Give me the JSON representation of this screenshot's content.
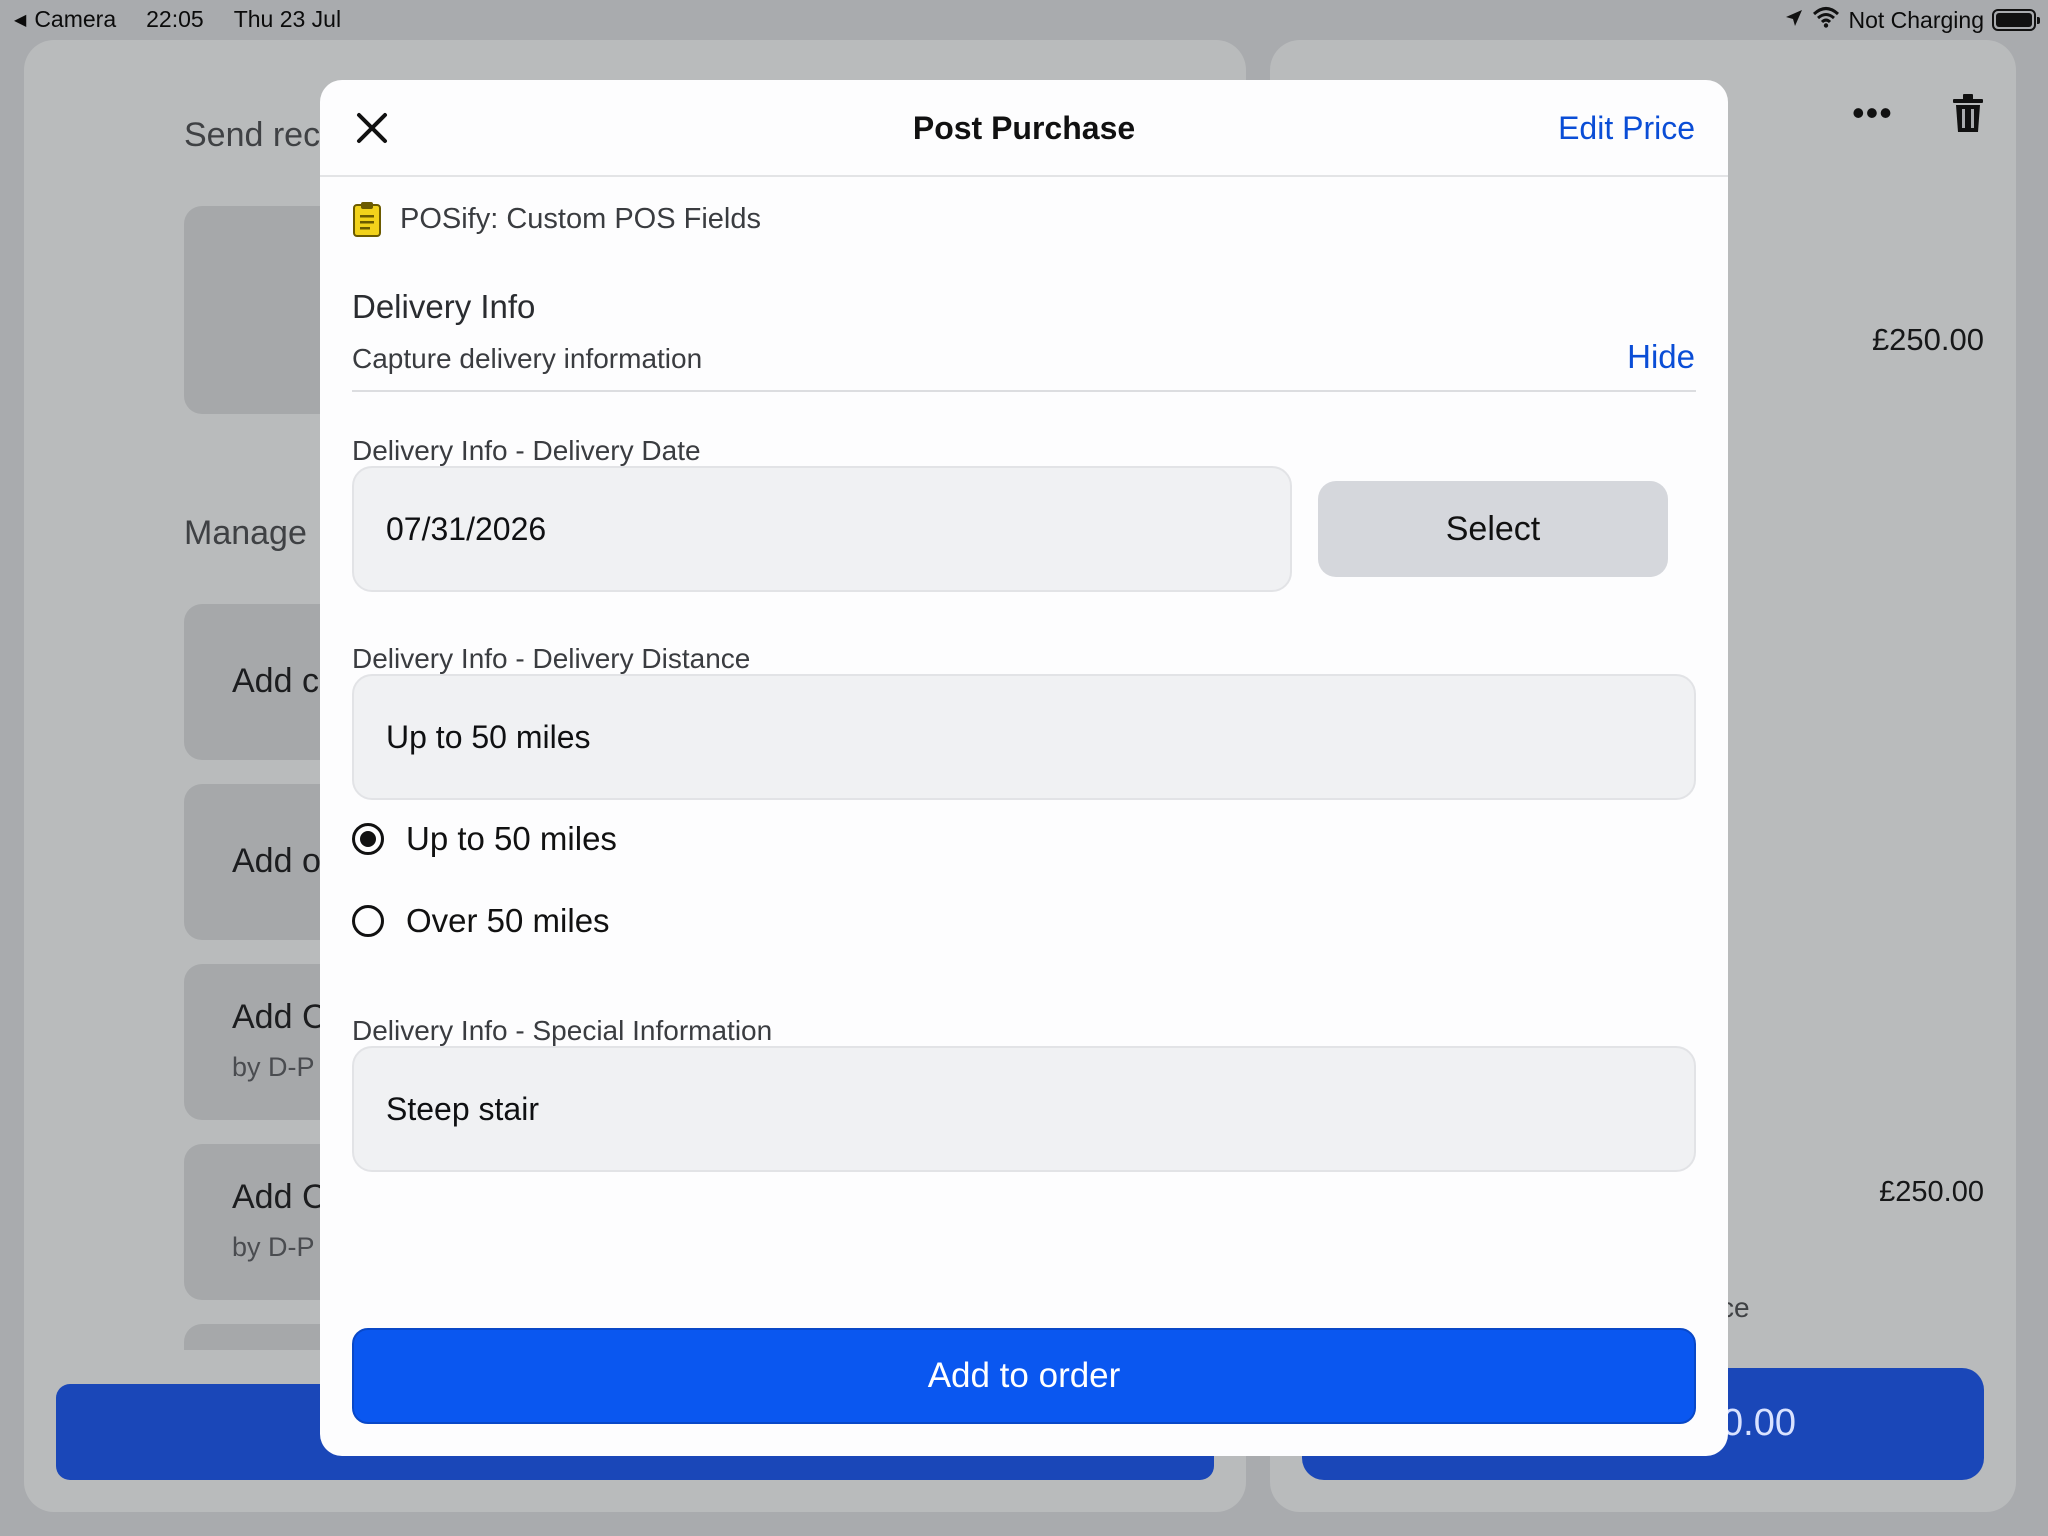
{
  "status_bar": {
    "back_label": "Camera",
    "time": "22:05",
    "date": "Thu 23 Jul",
    "charging": "Not Charging"
  },
  "background": {
    "send_receipt": "Send rec",
    "manage": "Manage",
    "cards": [
      {
        "title": "Add c",
        "subtitle": ""
      },
      {
        "title": "Add o",
        "subtitle": ""
      },
      {
        "title": "Add C",
        "subtitle": "by D-P"
      },
      {
        "title": "Add C",
        "subtitle": "by D-P"
      }
    ],
    "price_top": "£250.00",
    "price_bottom": "£250.00",
    "partial_text": "ce",
    "partial_button": "0.00"
  },
  "modal": {
    "title": "Post Purchase",
    "edit_price": "Edit Price",
    "app_name": "POSify: Custom POS Fields",
    "section_title": "Delivery Info",
    "section_subtitle": "Capture delivery information",
    "hide_label": "Hide",
    "date_label": "Delivery Info - Delivery Date",
    "date_value": "07/31/2026",
    "select_label": "Select",
    "distance_label": "Delivery Info - Delivery Distance",
    "distance_value": "Up to 50 miles",
    "options": [
      {
        "label": "Up to 50 miles",
        "selected": true
      },
      {
        "label": "Over 50 miles",
        "selected": false
      }
    ],
    "special_label": "Delivery Info - Special Information",
    "special_value": "Steep stair",
    "add_button": "Add to order"
  },
  "colors": {
    "accent": "#0a57f0",
    "link": "#0a4dd6",
    "app_icon": "#f2d21b"
  }
}
